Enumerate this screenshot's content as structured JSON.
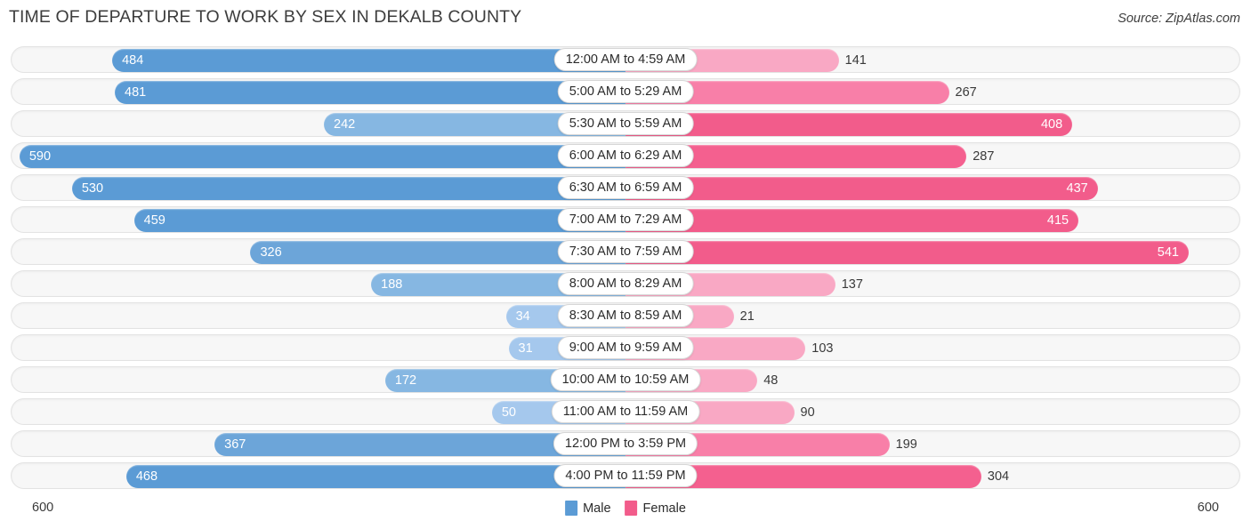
{
  "header": {
    "title": "TIME OF DEPARTURE TO WORK BY SEX IN DEKALB COUNTY",
    "source": "Source: ZipAtlas.com"
  },
  "footer": {
    "axis_left": "600",
    "axis_right": "600",
    "legend": [
      {
        "label": "Male",
        "color": "#5b9bd5"
      },
      {
        "label": "Female",
        "color": "#f25c8b"
      }
    ]
  },
  "chart_data": {
    "type": "bar",
    "subtype": "diverging-butterfly",
    "title": "TIME OF DEPARTURE TO WORK BY SEX IN DEKALB COUNTY",
    "xlabel": "",
    "ylabel": "",
    "xlim": [
      600,
      600
    ],
    "axis_max": 600,
    "grid": false,
    "legend_position": "bottom-center",
    "categories": [
      "12:00 AM to 4:59 AM",
      "5:00 AM to 5:29 AM",
      "5:30 AM to 5:59 AM",
      "6:00 AM to 6:29 AM",
      "6:30 AM to 6:59 AM",
      "7:00 AM to 7:29 AM",
      "7:30 AM to 7:59 AM",
      "8:00 AM to 8:29 AM",
      "8:30 AM to 8:59 AM",
      "9:00 AM to 9:59 AM",
      "10:00 AM to 10:59 AM",
      "11:00 AM to 11:59 AM",
      "12:00 PM to 3:59 PM",
      "4:00 PM to 11:59 PM"
    ],
    "series": [
      {
        "name": "Male",
        "direction": "left",
        "color": "#5b9bd5",
        "values": [
          484,
          481,
          242,
          590,
          530,
          459,
          326,
          188,
          34,
          31,
          172,
          50,
          367,
          468
        ]
      },
      {
        "name": "Female",
        "direction": "right",
        "color": "#f25c8b",
        "values": [
          141,
          267,
          408,
          287,
          437,
          415,
          541,
          137,
          21,
          103,
          48,
          90,
          199,
          304
        ]
      }
    ]
  },
  "rows": [
    {
      "label": "12:00 AM to 4:59 AM",
      "male": 484,
      "female": 141
    },
    {
      "label": "5:00 AM to 5:29 AM",
      "male": 481,
      "female": 267
    },
    {
      "label": "5:30 AM to 5:59 AM",
      "male": 242,
      "female": 408
    },
    {
      "label": "6:00 AM to 6:29 AM",
      "male": 590,
      "female": 287
    },
    {
      "label": "6:30 AM to 6:59 AM",
      "male": 530,
      "female": 437
    },
    {
      "label": "7:00 AM to 7:29 AM",
      "male": 459,
      "female": 415
    },
    {
      "label": "7:30 AM to 7:59 AM",
      "male": 326,
      "female": 541
    },
    {
      "label": "8:00 AM to 8:29 AM",
      "male": 188,
      "female": 137
    },
    {
      "label": "8:30 AM to 8:59 AM",
      "male": 34,
      "female": 21
    },
    {
      "label": "9:00 AM to 9:59 AM",
      "male": 31,
      "female": 103
    },
    {
      "label": "10:00 AM to 10:59 AM",
      "male": 172,
      "female": 48
    },
    {
      "label": "11:00 AM to 11:59 AM",
      "male": 50,
      "female": 90
    },
    {
      "label": "12:00 PM to 3:59 PM",
      "male": 367,
      "female": 199
    },
    {
      "label": "4:00 PM to 11:59 PM",
      "male": 468,
      "female": 304
    }
  ]
}
